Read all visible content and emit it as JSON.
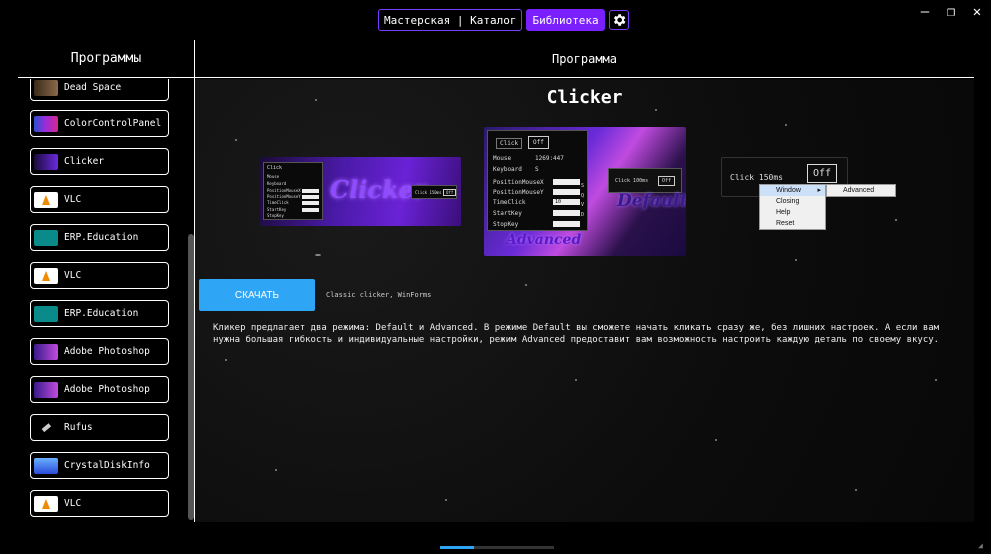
{
  "nav": {
    "workshop_catalog": "Мастерская | Каталог",
    "library": "Библиотека",
    "settings_icon": "gear-icon"
  },
  "window": {
    "minimize": "—",
    "restore": "❐",
    "close": "✕"
  },
  "sidebar": {
    "title": "Программы",
    "items": [
      {
        "label": "Dead Space",
        "icon": "dead-space-icon",
        "color": "#5a4a3a"
      },
      {
        "label": "ColorControlPanel",
        "icon": "color-control-panel-icon",
        "color": "#7a3cc8"
      },
      {
        "label": "Clicker",
        "icon": "clicker-icon",
        "color": "#5a2ab8"
      },
      {
        "label": "VLC",
        "icon": "vlc-icon",
        "color": "#f08a00"
      },
      {
        "label": "ERP.Education",
        "icon": "erp-education-icon",
        "color": "#0b8a8a"
      },
      {
        "label": "VLC",
        "icon": "vlc-icon",
        "color": "#f08a00"
      },
      {
        "label": "ERP.Education",
        "icon": "erp-education-icon",
        "color": "#0b8a8a"
      },
      {
        "label": "Adobe Photoshop",
        "icon": "photoshop-icon",
        "color": "#6a3ac8"
      },
      {
        "label": "Adobe Photoshop",
        "icon": "photoshop-icon",
        "color": "#6a3ac8"
      },
      {
        "label": "Rufus",
        "icon": "rufus-icon",
        "color": "#cccccc"
      },
      {
        "label": "CrystalDiskInfo",
        "icon": "crystaldiskinfo-icon",
        "color": "#2a6ad8"
      },
      {
        "label": "VLC",
        "icon": "vlc-icon",
        "color": "#f08a00"
      }
    ]
  },
  "main": {
    "header": "Программа",
    "app_title": "Clicker",
    "download_label": "СКАЧАТЬ",
    "caption": "Classic clicker, WinForms",
    "description": "Кликер предлагает два режима: Default и Advanced. В режиме Default вы сможете начать кликать сразу же, без лишних настроек. А если вам нужна большая гибкость и индивидуальные настройки, режим Advanced предоставит вам возможность настроить каждую деталь по своему вкусу."
  },
  "screenshots": {
    "shot1": {
      "logo": "Clicker",
      "panel_rows": [
        "Mouse",
        "Keyboard",
        "PositionMouseX",
        "PositionMouseY",
        "TimeClick",
        "StartKey",
        "StopKey"
      ],
      "click_label": "Click 150ms",
      "off_label": "Off"
    },
    "shot2": {
      "click_btn": "Click",
      "off_btn": "Off",
      "mouse_label": "Mouse",
      "mouse_value": "1269:447",
      "keyboard_label": "Keyboard",
      "keyboard_value": "S",
      "rows": [
        "PositionMouseX",
        "PositionMouseY",
        "TimeClick",
        "StartKey",
        "StopKey"
      ],
      "timeclick_value": "10",
      "side_letters": [
        "S",
        "Q",
        "V",
        "D"
      ],
      "mini_click": "Click 100ms",
      "mini_off": "Off",
      "word_default": "Default",
      "word_advanced": "Advanced"
    },
    "shot3": {
      "click_label": "Click 150ms",
      "off_label": "Off",
      "menu_items": [
        "Window",
        "Closing",
        "Help",
        "Reset"
      ],
      "submenu_item": "Advanced"
    }
  },
  "colors": {
    "accent_purple": "#7a20ff",
    "download_blue": "#2ea5f5"
  }
}
